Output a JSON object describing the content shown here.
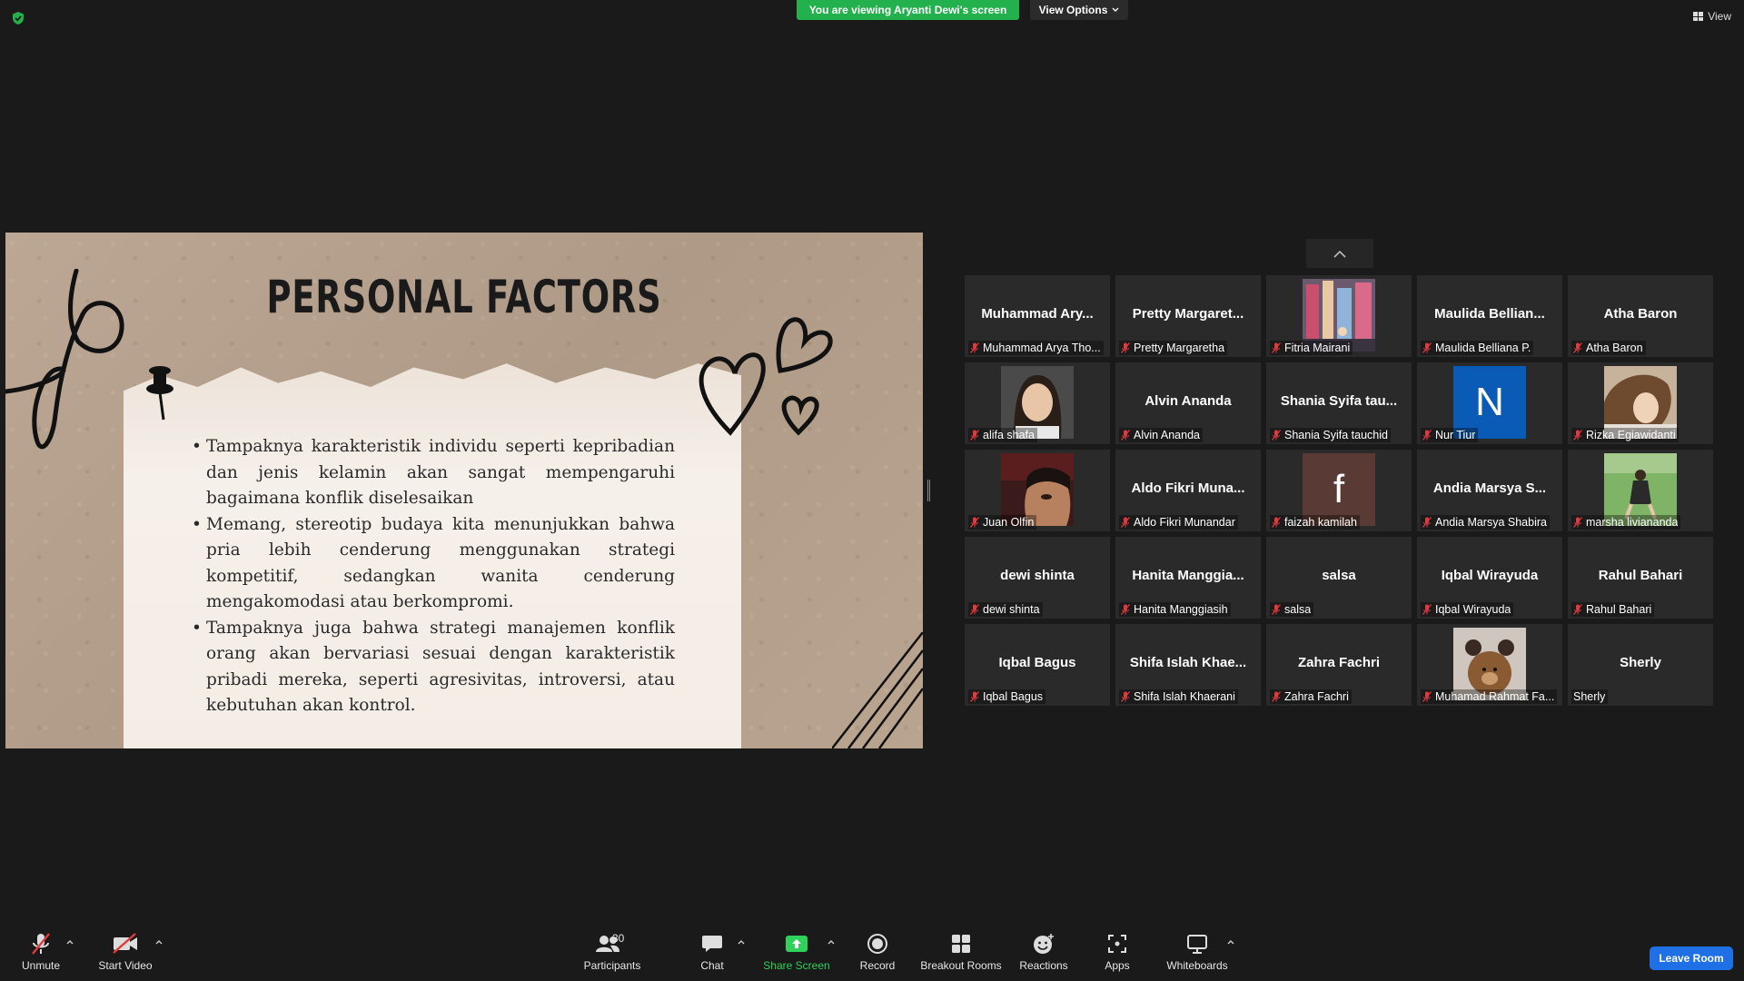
{
  "top": {
    "viewing_banner": "You are viewing Aryanti Dewi's screen",
    "view_options": "View Options",
    "view_label": "View"
  },
  "slide": {
    "title": "PERSONAL FACTORS",
    "bullets": [
      "Tampaknya karakteristik individu seperti kepribadian dan jenis kelamin akan sangat mempengaruhi bagaimana konflik diselesaikan",
      "Memang, stereotip budaya kita menunjukkan bahwa pria lebih cenderung menggunakan strategi kompetitif, sedangkan wanita cenderung mengakomodasi atau berkompromi.",
      "Tampaknya juga bahwa strategi manajemen konflik orang akan bervariasi sesuai dengan karakteristik pribadi mereka, seperti agresivitas, introversi, atau kebutuhan akan kontrol."
    ]
  },
  "participants": [
    {
      "big": "Muhammad Ary...",
      "label": "Muhammad Arya Tho...",
      "muted": true,
      "kind": "name"
    },
    {
      "big": "Pretty Margaret...",
      "label": "Pretty Margaretha",
      "muted": true,
      "kind": "name"
    },
    {
      "big": "",
      "label": "Fitria Mairani",
      "muted": true,
      "kind": "photo-city"
    },
    {
      "big": "Maulida Bellian...",
      "label": "Maulida Belliana P.",
      "muted": true,
      "kind": "name"
    },
    {
      "big": "Atha Baron",
      "label": "Atha Baron",
      "muted": true,
      "kind": "name"
    },
    {
      "big": "",
      "label": "alifa shafa",
      "muted": true,
      "kind": "photo-face"
    },
    {
      "big": "Alvin Ananda",
      "label": "Alvin Ananda",
      "muted": true,
      "kind": "name"
    },
    {
      "big": "Shania Syifa tau...",
      "label": "Shania Syifa tauchid",
      "muted": true,
      "kind": "name"
    },
    {
      "big": "N",
      "label": "Nur Tiur",
      "muted": true,
      "kind": "initial-blue"
    },
    {
      "big": "",
      "label": "Rizka Egiawidanti",
      "muted": true,
      "kind": "photo-hijab"
    },
    {
      "big": "",
      "label": "Juan Olfin",
      "muted": true,
      "kind": "photo-man"
    },
    {
      "big": "Aldo Fikri Muna...",
      "label": "Aldo Fikri Munandar",
      "muted": true,
      "kind": "name"
    },
    {
      "big": "f",
      "label": "faizah kamilah",
      "muted": true,
      "kind": "initial-brown"
    },
    {
      "big": "Andia Marsya S...",
      "label": "Andia Marsya Shabira",
      "muted": true,
      "kind": "name"
    },
    {
      "big": "",
      "label": "marsha livianandа",
      "muted": true,
      "kind": "photo-grass"
    },
    {
      "big": "dewi shinta",
      "label": "dewi shinta",
      "muted": true,
      "kind": "name"
    },
    {
      "big": "Hanita Manggia...",
      "label": "Hanita Manggiasih",
      "muted": true,
      "kind": "name"
    },
    {
      "big": "salsa",
      "label": "salsa",
      "muted": true,
      "kind": "name"
    },
    {
      "big": "Iqbal Wirayuda",
      "label": "Iqbal Wirayuda",
      "muted": true,
      "kind": "name"
    },
    {
      "big": "Rahul Bahari",
      "label": "Rahul Bahari",
      "muted": true,
      "kind": "name"
    },
    {
      "big": "Iqbal Bagus",
      "label": "Iqbal Bagus",
      "muted": true,
      "kind": "name"
    },
    {
      "big": "Shifa Islah Khae...",
      "label": "Shifa Islah Khaerani",
      "muted": true,
      "kind": "name"
    },
    {
      "big": "Zahra Fachri",
      "label": "Zahra Fachri",
      "muted": true,
      "kind": "name"
    },
    {
      "big": "",
      "label": "Muhamad Rahmat Fa...",
      "muted": true,
      "kind": "photo-bear"
    },
    {
      "big": "Sherly",
      "label": "Sherly",
      "muted": false,
      "kind": "name"
    }
  ],
  "toolbar": {
    "unmute": "Unmute",
    "start_video": "Start Video",
    "participants": "Participants",
    "participants_count": "30",
    "chat": "Chat",
    "share_screen": "Share Screen",
    "record": "Record",
    "breakout_rooms": "Breakout Rooms",
    "reactions": "Reactions",
    "apps": "Apps",
    "whiteboards": "Whiteboards",
    "leave_room": "Leave Room"
  },
  "colors": {
    "banner_green": "#23b14d",
    "leave_blue": "#1f6fe5",
    "share_green": "#2fd15a",
    "mic_red": "#e0393e"
  }
}
